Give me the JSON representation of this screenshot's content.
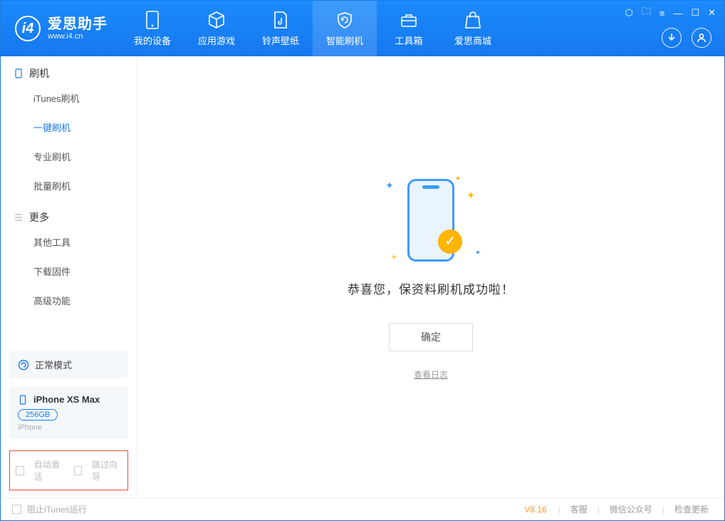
{
  "app": {
    "name": "爱思助手",
    "domain": "www.i4.cn"
  },
  "nav": {
    "items": [
      {
        "label": "我的设备"
      },
      {
        "label": "应用游戏"
      },
      {
        "label": "铃声壁纸"
      },
      {
        "label": "智能刷机"
      },
      {
        "label": "工具箱"
      },
      {
        "label": "爱思商城"
      }
    ]
  },
  "sidebar": {
    "section1": "刷机",
    "items1": [
      {
        "label": "iTunes刷机"
      },
      {
        "label": "一键刷机"
      },
      {
        "label": "专业刷机"
      },
      {
        "label": "批量刷机"
      }
    ],
    "section2": "更多",
    "items2": [
      {
        "label": "其他工具"
      },
      {
        "label": "下载固件"
      },
      {
        "label": "高级功能"
      }
    ],
    "mode": "正常模式",
    "device": {
      "name": "iPhone XS Max",
      "capacity": "256GB",
      "type": "iPhone"
    },
    "checks": {
      "auto_activate": "自动激活",
      "skip_guide": "跳过向导"
    }
  },
  "main": {
    "message": "恭喜您，保资料刷机成功啦！",
    "ok": "确定",
    "view_log": "查看日志"
  },
  "footer": {
    "block_itunes": "阻止iTunes运行",
    "version": "V8.16",
    "links": {
      "service": "客服",
      "wechat": "微信公众号",
      "update": "检查更新"
    }
  }
}
